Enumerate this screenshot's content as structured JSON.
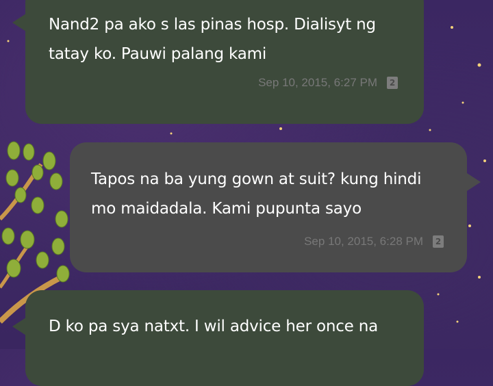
{
  "theme": {
    "incoming_bubble_color": "#3d4a3b",
    "outgoing_bubble_color": "#4b4b4b",
    "text_color": "#ffffff",
    "meta_color": "#787878",
    "wallpaper": "purple night sky with tree and fireflies"
  },
  "messages": [
    {
      "direction": "incoming",
      "lines": [
        "Nand2 pa ako s las pinas hosp. Dialisyt ng",
        "tatay ko. Pauwi palang kami"
      ],
      "timestamp": "Sep 10, 2015, 6:27 PM",
      "sim_indicator": "2"
    },
    {
      "direction": "outgoing",
      "lines": [
        "Tapos na ba yung gown at suit? kung hindi",
        "mo maidadala. Kami pupunta sayo"
      ],
      "timestamp": "Sep 10, 2015, 6:28 PM",
      "sim_indicator": "2"
    },
    {
      "direction": "incoming",
      "lines": [
        "D ko pa sya natxt. I wil advice her once na"
      ]
    }
  ]
}
